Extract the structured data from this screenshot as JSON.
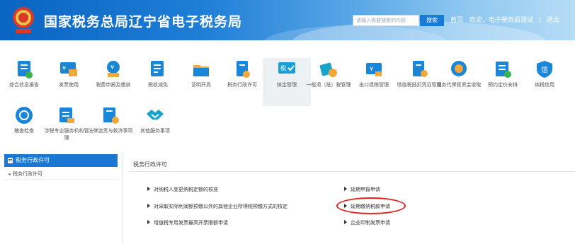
{
  "header": {
    "title": "国家税务总局辽宁省电子税务局",
    "search_placeholder": "请输入需要搜索的内容",
    "search_button": "搜索",
    "home_link": "首页",
    "welcome_text": "欢迎，电子税务局测试",
    "logout_link": "退出",
    "emblem_text": "中国税务"
  },
  "grid": {
    "row1": [
      {
        "label": "综合信息报告",
        "icon": "report-icon",
        "color": "#1a86d8"
      },
      {
        "label": "发票使用",
        "icon": "invoice-icon",
        "color": "#1a86d8"
      },
      {
        "label": "税费申报及缴纳",
        "icon": "tax-payment-icon",
        "color": "#1a86d8"
      },
      {
        "label": "税收减免",
        "icon": "tax-relief-icon",
        "color": "#1a86d8"
      },
      {
        "label": "证明开具",
        "icon": "certificate-icon",
        "color": "#1a86d8"
      },
      {
        "label": "税务行政许可",
        "icon": "admin-license-icon",
        "color": "#1a86d8"
      },
      {
        "label": "核定管理",
        "icon": "assessment-icon",
        "color": "#1a86d8",
        "active": true
      },
      {
        "label": "一般退（抵）税管理",
        "icon": "tax-refund-icon",
        "color": "#1a86d8"
      },
      {
        "label": "出口退税管理",
        "icon": "export-refund-icon",
        "color": "#1a86d8"
      },
      {
        "label": "增值税抵扣凭证管理",
        "icon": "vat-deduction-icon",
        "color": "#1a86d8"
      },
      {
        "label": "税务代保管资金收取",
        "icon": "custody-fund-icon",
        "color": "#1a86d8"
      },
      {
        "label": "预约定价安排",
        "icon": "pricing-arrangement-icon",
        "color": "#1a86d8"
      },
      {
        "label": "纳税信用",
        "icon": "tax-credit-icon",
        "color": "#1a86d8"
      }
    ],
    "row2": [
      {
        "label": "稽查检查",
        "icon": "inspection-icon",
        "color": "#1a86d8"
      },
      {
        "label": "涉税专业服务机构管理",
        "icon": "service-agency-icon",
        "color": "#1a86d8"
      },
      {
        "label": "法律追责与救济事项",
        "icon": "legal-remedy-icon",
        "color": "#1a86d8"
      },
      {
        "label": "其他服务事项",
        "icon": "handshake-icon",
        "color": "#1a86d8"
      }
    ]
  },
  "sidebar": {
    "header": "税务行政许可",
    "items": [
      "税务行政许可"
    ]
  },
  "main": {
    "title": "税务行政许可",
    "links_left": [
      "对纳税人变更纳税定额的核准",
      "对采取实际利润额预缴以外的其他企业所得税预缴方式的核定",
      "增值税专用发票最高开票限额申请"
    ],
    "links_right": [
      "延期申报申请",
      "延期缴纳税款申请",
      "企业印制发票申请"
    ]
  }
}
